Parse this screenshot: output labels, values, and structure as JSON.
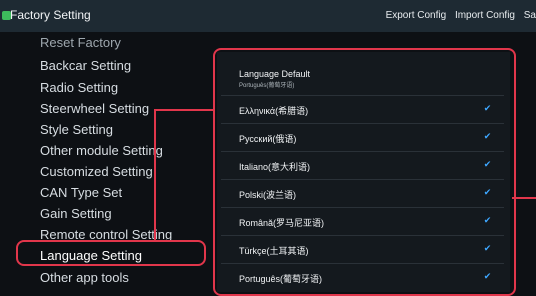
{
  "app": {
    "title": "Factory Setting",
    "actions": [
      "Export Config",
      "Import Config",
      "Sa"
    ]
  },
  "sidebar": {
    "items": [
      {
        "label": "Reset Factory",
        "state": "partial"
      },
      {
        "label": "Backcar Setting"
      },
      {
        "label": "Radio Setting"
      },
      {
        "label": "Steerwheel Setting"
      },
      {
        "label": "Style Setting"
      },
      {
        "label": "Other module Setting"
      },
      {
        "label": "Customized Setting"
      },
      {
        "label": "CAN Type Set"
      },
      {
        "label": "Gain Setting"
      },
      {
        "label": "Remote control Setting"
      },
      {
        "label": "Language Setting",
        "state": "active"
      },
      {
        "label": "Other app tools"
      }
    ]
  },
  "languages": [
    {
      "title": "Language Default",
      "subtitle": "Português(葡萄牙语)",
      "checked": false
    },
    {
      "title": "Ελληνικά(希腊语)",
      "checked": true
    },
    {
      "title": "Русский(俄语)",
      "checked": true
    },
    {
      "title": "Italiano(意大利语)",
      "checked": true
    },
    {
      "title": "Polski(波兰语)",
      "checked": true
    },
    {
      "title": "Română(罗马尼亚语)",
      "checked": true
    },
    {
      "title": "Türkçe(土耳其语)",
      "checked": true
    },
    {
      "title": "Português(葡萄牙语)",
      "checked": true
    }
  ],
  "colors": {
    "annotation": "#e1364b",
    "checkmark": "#3ea7ff",
    "topbar": "#1e2a33"
  },
  "icons": {
    "app": "android-app-icon",
    "check": "checkmark-icon"
  }
}
